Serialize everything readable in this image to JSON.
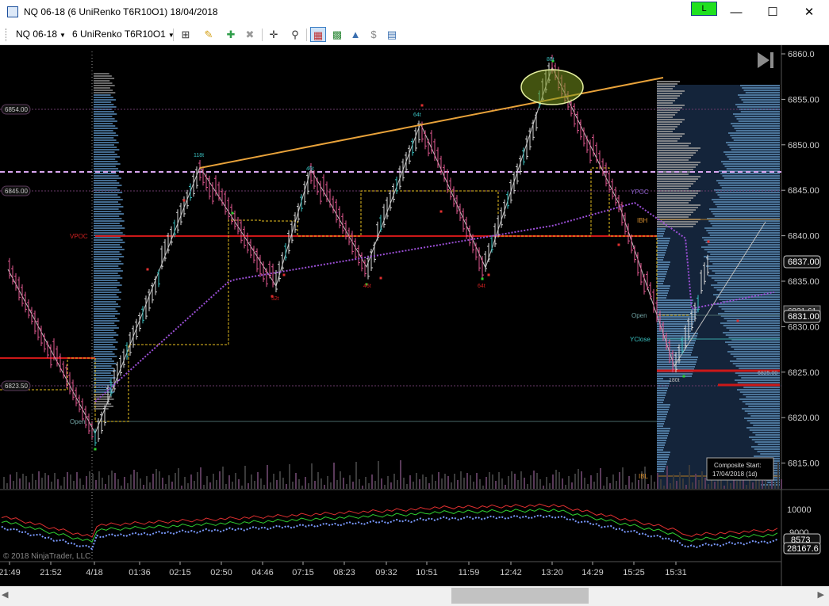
{
  "window": {
    "title": "NQ 06-18 (6 UniRenko T6R10O1)  18/04/2018",
    "connection_indicator": "L",
    "minimize_icon": "minimize-icon",
    "maximize_icon": "maximize-icon",
    "close_icon": "close-icon"
  },
  "toolbar": {
    "instrument": "NQ 06-18",
    "bar_type": "6 UniRenko T6R10O1",
    "icons": [
      "bar-style-icon",
      "drawing-tools-icon",
      "add-drawing-icon",
      "remove-drawing-icon",
      "crosshair-icon",
      "zoom-icon",
      "chart-trader-icon",
      "strategies-icon",
      "indicators-icon",
      "price-ladder-icon",
      "properties-icon"
    ]
  },
  "price_axis": {
    "ticks": [
      "6860.0",
      "6855.00",
      "6850.00",
      "6845.00",
      "6840.00",
      "6835.00",
      "6830.00",
      "6825.00",
      "6820.00",
      "6815.00"
    ],
    "last_price_label": "6837.00",
    "marker_label_a": "6831.61",
    "marker_label_b": "6831.00"
  },
  "left_price_labels": {
    "top": "6854.00",
    "mid": "6845.00",
    "low": "6823.50"
  },
  "chart_labels": {
    "vpoc": "VPOC",
    "open_left": "Open",
    "ypoc": "YPOC",
    "ibh": "IBH",
    "open_right": "Open",
    "yclose": "YClose",
    "ibl": "IBL",
    "profile_price": "6825.00",
    "swing_labels": [
      "118t",
      "64t",
      "46t",
      "88t",
      "52t",
      "46t",
      "64t",
      "180t"
    ],
    "copyright": "© 2018 NinjaTrader, LLC"
  },
  "composite_box": {
    "line1": "Composite Start:",
    "line2": "17/04/2018 (1d)"
  },
  "indicator_axis": {
    "ticks": [
      "10000",
      "9000"
    ],
    "value_a": "8573",
    "value_b": "28167.6"
  },
  "time_axis": {
    "labels": [
      "21:49",
      "21:52",
      "4/18",
      "01:36",
      "02:15",
      "02:50",
      "04:46",
      "07:15",
      "08:23",
      "09:32",
      "10:51",
      "11:59",
      "12:42",
      "13:20",
      "14:29",
      "15:25",
      "15:31"
    ]
  },
  "colors": {
    "background": "#000000",
    "up_bar": "#d2d2d2",
    "down_bar": "#e0578f",
    "trendline": "#e8a23a",
    "vwap": "#9b4fd6",
    "value_area_line": "#e8c020",
    "vpoc_line": "#cc1818",
    "profile_prev": "#4f7ea8",
    "profile_curr": "#8a8a8a"
  }
}
